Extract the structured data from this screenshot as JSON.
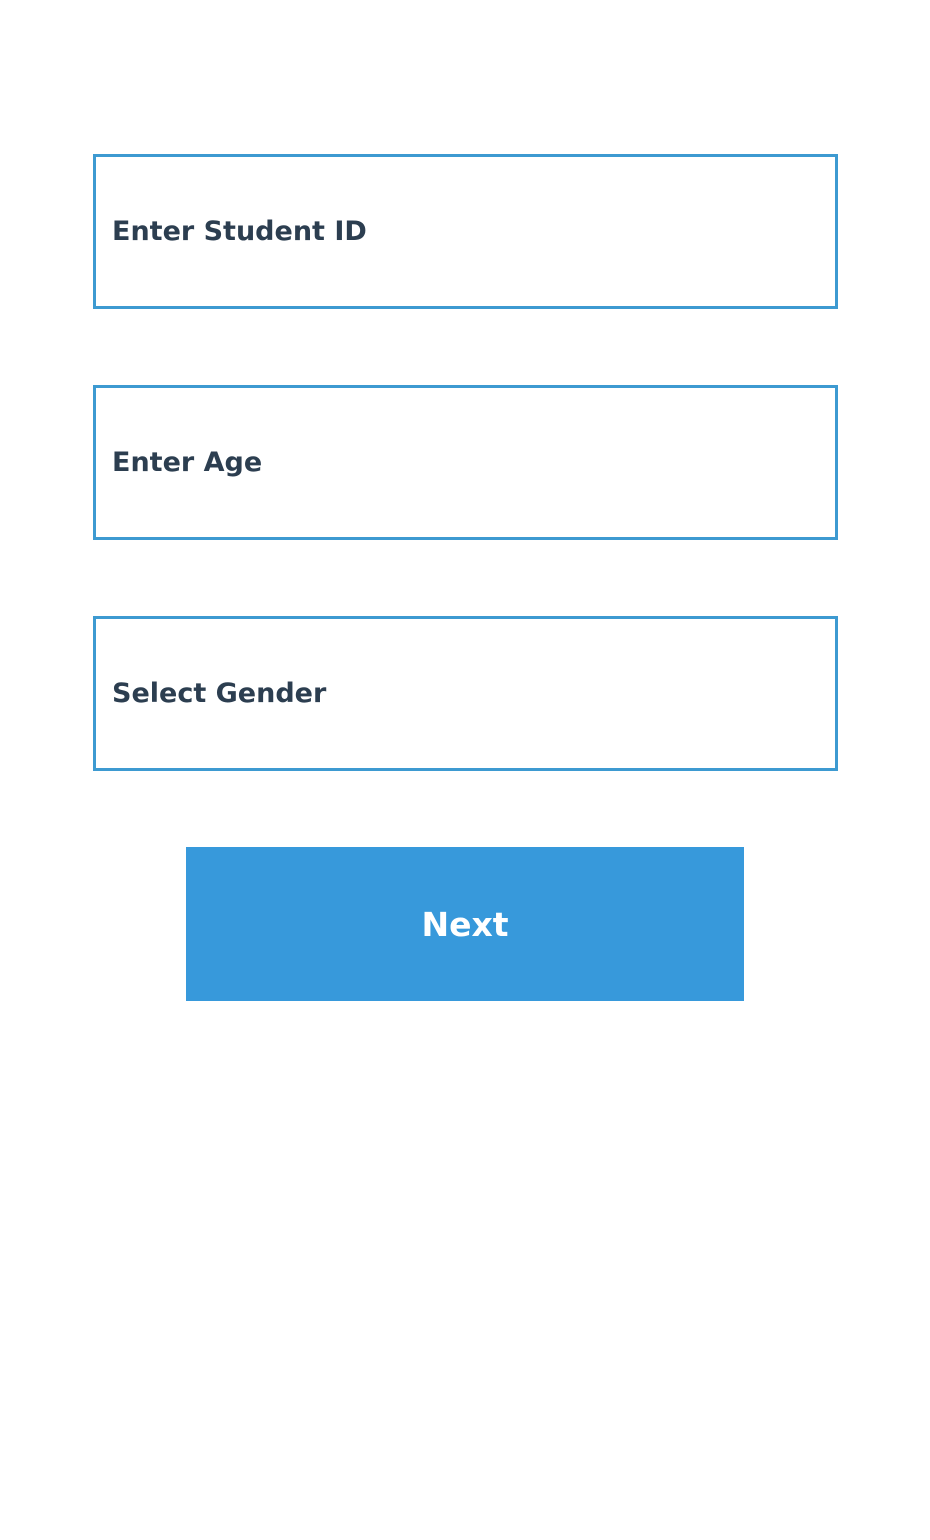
{
  "form": {
    "student_id": {
      "value": "",
      "placeholder": "Enter Student ID"
    },
    "age": {
      "value": "",
      "placeholder": "Enter Age"
    },
    "gender": {
      "selected_label": "Select Gender"
    },
    "next_button_label": "Next"
  },
  "colors": {
    "field_border": "#3d9ad1",
    "text": "#2c3e50",
    "button_bg": "#3799db",
    "button_text": "#ffffff",
    "background": "#ffffff"
  }
}
